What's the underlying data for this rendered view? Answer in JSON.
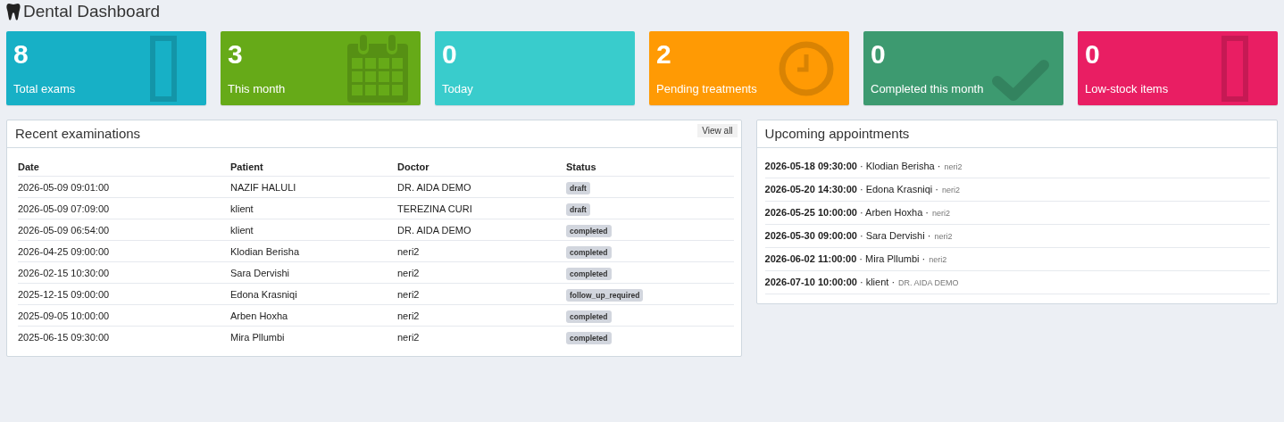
{
  "page": {
    "title": "Dental Dashboard"
  },
  "stats": [
    {
      "value": "8",
      "label": "Total exams",
      "color": "#17b0c6",
      "kind": "box"
    },
    {
      "value": "3",
      "label": "This month",
      "color": "#66aa18",
      "kind": "calendar"
    },
    {
      "value": "0",
      "label": "Today",
      "color": "#39cccc"
    },
    {
      "value": "2",
      "label": "Pending treatments",
      "color": "#ff9a04",
      "kind": "clock"
    },
    {
      "value": "0",
      "label": "Completed this month",
      "color": "#3d9a70",
      "kind": "check"
    },
    {
      "value": "0",
      "label": "Low-stock items",
      "color": "#e91e63",
      "kind": "box"
    }
  ],
  "recent_examinations": {
    "title": "Recent examinations",
    "view_all": "View all",
    "columns": [
      "Date",
      "Patient",
      "Doctor",
      "Status"
    ],
    "rows": [
      {
        "date": "2026-05-09 09:01:00",
        "patient": "NAZIF HALULI",
        "doctor": "DR. AIDA DEMO",
        "status": "draft"
      },
      {
        "date": "2026-05-09 07:09:00",
        "patient": "klient",
        "doctor": "TEREZINA CURI",
        "status": "draft"
      },
      {
        "date": "2026-05-09 06:54:00",
        "patient": "klient",
        "doctor": "DR. AIDA DEMO",
        "status": "completed"
      },
      {
        "date": "2026-04-25 09:00:00",
        "patient": "Klodian Berisha",
        "doctor": "neri2",
        "status": "completed"
      },
      {
        "date": "2026-02-15 10:30:00",
        "patient": "Sara Dervishi",
        "doctor": "neri2",
        "status": "completed"
      },
      {
        "date": "2025-12-15 09:00:00",
        "patient": "Edona Krasniqi",
        "doctor": "neri2",
        "status": "follow_up_required"
      },
      {
        "date": "2025-09-05 10:00:00",
        "patient": "Arben Hoxha",
        "doctor": "neri2",
        "status": "completed"
      },
      {
        "date": "2025-06-15 09:30:00",
        "patient": "Mira Pllumbi",
        "doctor": "neri2",
        "status": "completed"
      }
    ]
  },
  "upcoming_appointments": {
    "title": "Upcoming appointments",
    "rows": [
      {
        "datetime": "2026-05-18 09:30:00",
        "patient": "· Klodian Berisha ·",
        "doctor": "neri2"
      },
      {
        "datetime": "2026-05-20 14:30:00",
        "patient": "· Edona Krasniqi ·",
        "doctor": "neri2"
      },
      {
        "datetime": "2026-05-25 10:00:00",
        "patient": "· Arben Hoxha ·",
        "doctor": "neri2"
      },
      {
        "datetime": "2026-05-30 09:00:00",
        "patient": "· Sara Dervishi ·",
        "doctor": "neri2"
      },
      {
        "datetime": "2026-06-02 11:00:00",
        "patient": "· Mira Pllumbi ·",
        "doctor": "neri2"
      },
      {
        "datetime": "2026-07-10 10:00:00",
        "patient": "· klient ·",
        "doctor": "DR. AIDA DEMO"
      }
    ]
  }
}
